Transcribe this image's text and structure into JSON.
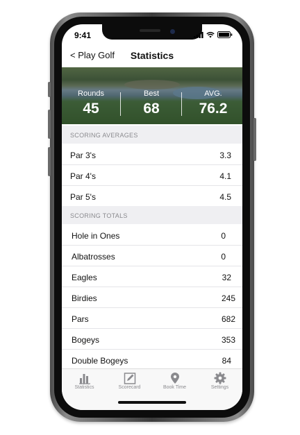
{
  "status_bar": {
    "time": "9:41"
  },
  "nav": {
    "back_label": "< Play Golf",
    "title": "Statistics"
  },
  "summary": [
    {
      "label": "Rounds",
      "value": "45"
    },
    {
      "label": "Best",
      "value": "68"
    },
    {
      "label": "AVG.",
      "value": "76.2"
    }
  ],
  "scoring_averages": {
    "heading": "SCORING AVERAGES",
    "rows": [
      {
        "label": "Par 3's",
        "value": "3.3"
      },
      {
        "label": "Par 4's",
        "value": "4.1"
      },
      {
        "label": "Par 5's",
        "value": "4.5"
      }
    ]
  },
  "scoring_totals": {
    "heading": "SCORING TOTALS",
    "rows": [
      {
        "label": "Hole in Ones",
        "value": "0"
      },
      {
        "label": "Albatrosses",
        "value": "0"
      },
      {
        "label": "Eagles",
        "value": "32"
      },
      {
        "label": "Birdies",
        "value": "245"
      },
      {
        "label": "Pars",
        "value": "682"
      },
      {
        "label": "Bogeys",
        "value": "353"
      },
      {
        "label": "Double Bogeys",
        "value": "84"
      }
    ]
  },
  "tabbar": {
    "items": [
      {
        "label": "Statistics",
        "icon": "bar-chart-icon"
      },
      {
        "label": "Scorecard",
        "icon": "pencil-card-icon"
      },
      {
        "label": "Book Time",
        "icon": "map-pin-icon"
      },
      {
        "label": "Settings",
        "icon": "gear-icon"
      }
    ]
  },
  "colors": {
    "section_bg": "#efeff2",
    "tab_icon": "#8a8a8e",
    "text": "#111111"
  }
}
